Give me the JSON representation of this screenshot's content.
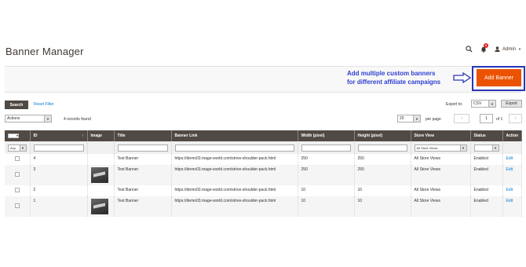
{
  "header": {
    "title": "Banner Manager",
    "user": "Admin",
    "notification_count": "8"
  },
  "promo": {
    "line1": "Add multiple custom banners",
    "line2": "for different affiliate campaigns"
  },
  "add_button_label": "Add Banner",
  "toolbar": {
    "search_label": "Search",
    "reset_label": "Reset Filter",
    "export_to_label": "Export to:",
    "export_format": "CSV",
    "export_button": "Export",
    "actions_label": "Actions",
    "records_found": "4 records found",
    "per_page_value": "20",
    "per_page_label": "per page",
    "current_page": "1",
    "page_total": "of 1"
  },
  "columns": [
    "ID",
    "Image",
    "Title",
    "Banner Link",
    "Width (pixel)",
    "Height (pixel)",
    "Store View",
    "Status",
    "Action"
  ],
  "filters": {
    "any": "Any",
    "store_view": "All Store Views"
  },
  "rows": [
    {
      "id": "4",
      "has_image": false,
      "title": "Test Banner",
      "link": "https://demo03.mage-world.com/strive-shoulder-pack.html",
      "width": "250",
      "height": "250",
      "store": "All Store Views",
      "status": "Enabled",
      "action": "Edit"
    },
    {
      "id": "3",
      "has_image": true,
      "title": "Test Banner",
      "link": "https://demo03.mage-world.com/strive-shoulder-pack.html",
      "width": "250",
      "height": "250",
      "store": "All Store Views",
      "status": "Enabled",
      "action": "Edit"
    },
    {
      "id": "2",
      "has_image": false,
      "title": "Test Banner",
      "link": "https://demo03.mage-world.com/strive-shoulder-pack.html",
      "width": "10",
      "height": "10",
      "store": "All Store Views",
      "status": "Enabled",
      "action": "Edit"
    },
    {
      "id": "1",
      "has_image": true,
      "title": "Test Banner",
      "link": "https://demo03.mage-world.com/strive-shoulder-pack.html",
      "width": "10",
      "height": "10",
      "store": "All Store Views",
      "status": "Enabled",
      "action": "Edit"
    }
  ],
  "colors": {
    "accent": "#eb5202",
    "header_dark": "#514943",
    "link": "#007bdb",
    "promo_text": "#2d3fd0"
  },
  "icons": [
    "search-icon",
    "bell-icon",
    "user-icon",
    "arrow-right-icon",
    "chevron-left-icon",
    "chevron-right-icon",
    "caret-down-icon",
    "sort-up-icon"
  ]
}
